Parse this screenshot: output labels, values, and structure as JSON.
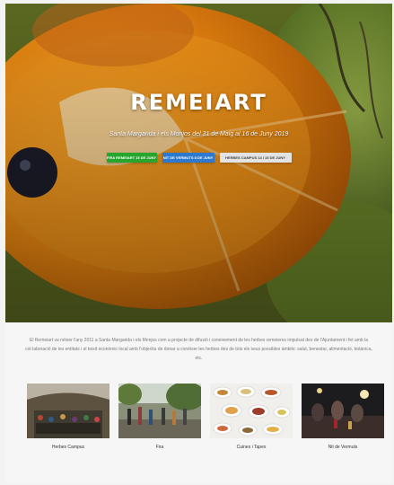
{
  "hero": {
    "title": "REMEIART",
    "subtitle": "Santa Margarida i els Monjos del 31 de Maig al 16 de Juny 2019",
    "buttons": [
      {
        "label": "FIRA REMEIART 15 DE JUNY",
        "color": "#27a52e"
      },
      {
        "label": "NIT DE VERMUTS 8 DE JUNY",
        "color": "#2d79cf"
      },
      {
        "label": "HERBES CAMPUS 14 I 15 DE JUNY",
        "color": "#e3e3e3"
      }
    ]
  },
  "intro": {
    "text": "El Remeiart va néixer l'any 2011 a Santa Margarida i els Monjos com a projecte de difusió i coneixement de les herbes remeieres impulsat des de l'Ajuntament i fet amb la col·laboració de les entitats i el teixit econòmic local amb l'objectiu de donar a conèixer les herbes des de tots els seus possibles àmbits: salut, benestar, alimentació, botànica, etc."
  },
  "gallery": [
    {
      "caption": "Herbes Campus",
      "icon": "herbes-campus-photo"
    },
    {
      "caption": "Fira",
      "icon": "fira-photo"
    },
    {
      "caption": "Cuines i Tapes",
      "icon": "cuines-tapes-photo"
    },
    {
      "caption": "Nit de Vermuts",
      "icon": "nit-vermuts-photo"
    }
  ]
}
